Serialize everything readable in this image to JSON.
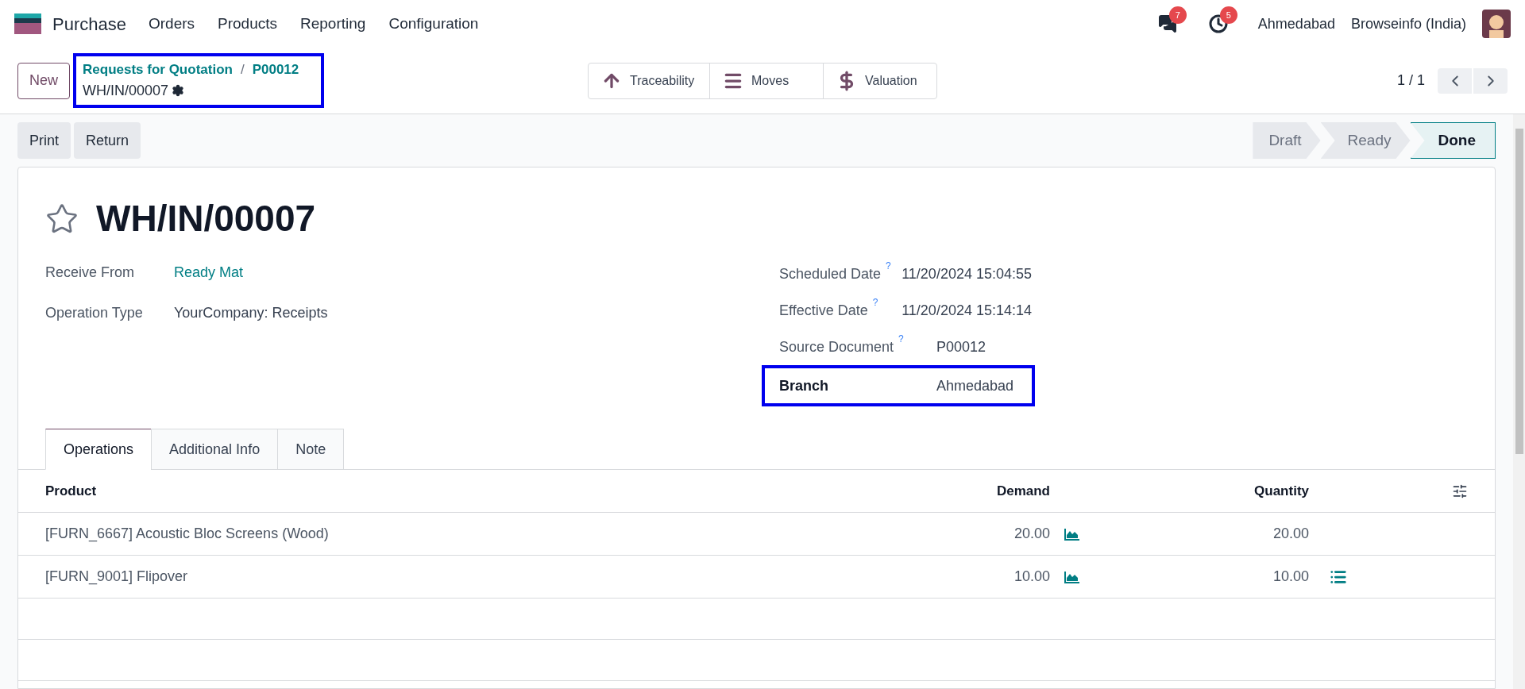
{
  "navbar": {
    "app": "Purchase",
    "menu": [
      "Orders",
      "Products",
      "Reporting",
      "Configuration"
    ],
    "messages_badge": "7",
    "activities_badge": "5",
    "branch": "Ahmedabad",
    "company": "Browseinfo (India)"
  },
  "control_panel": {
    "new_button": "New",
    "breadcrumb": {
      "highlighted": true,
      "parent": "Requests for Quotation",
      "separator": "/",
      "order": "P00012",
      "current": "WH/IN/00007"
    },
    "smart_buttons": [
      {
        "kind": "arrow",
        "label": "Traceability"
      },
      {
        "kind": "list",
        "label": "Moves"
      },
      {
        "kind": "dollar",
        "label": "Valuation"
      }
    ],
    "pager": "1 / 1"
  },
  "actions": [
    "Print",
    "Return"
  ],
  "status_steps": [
    {
      "label": "Draft",
      "selected": false
    },
    {
      "label": "Ready",
      "selected": false
    },
    {
      "label": "Done",
      "selected": true
    }
  ],
  "form": {
    "title": "WH/IN/00007",
    "favorite": false,
    "left_fields": [
      {
        "label": "Receive From",
        "value": "Ready Mat",
        "link": true
      },
      {
        "label": "Operation Type",
        "value": "YourCompany: Receipts",
        "link": false
      }
    ],
    "right_fields": [
      {
        "label": "Scheduled Date",
        "help": "?",
        "value": "11/20/2024 15:04:55",
        "highlighted": false
      },
      {
        "label": "Effective Date",
        "help": "?",
        "value": "11/20/2024 15:14:14",
        "highlighted": false
      },
      {
        "label": "Source Document",
        "help": "?",
        "value": "P00012",
        "highlighted": false
      },
      {
        "label": "Branch",
        "value": "Ahmedabad",
        "highlighted": true
      }
    ],
    "tabs": [
      {
        "label": "Operations",
        "selected": true
      },
      {
        "label": "Additional Info",
        "selected": false
      },
      {
        "label": "Note",
        "selected": false
      }
    ],
    "table": {
      "columns": [
        "Product",
        "Demand",
        "Quantity"
      ],
      "rows": [
        {
          "product": "[FURN_6667] Acoustic Bloc Screens (Wood)",
          "demand": "20.00",
          "quantity": "20.00",
          "has_details": false
        },
        {
          "product": "[FURN_9001] Flipover",
          "demand": "10.00",
          "quantity": "10.00",
          "has_details": true
        }
      ]
    }
  }
}
